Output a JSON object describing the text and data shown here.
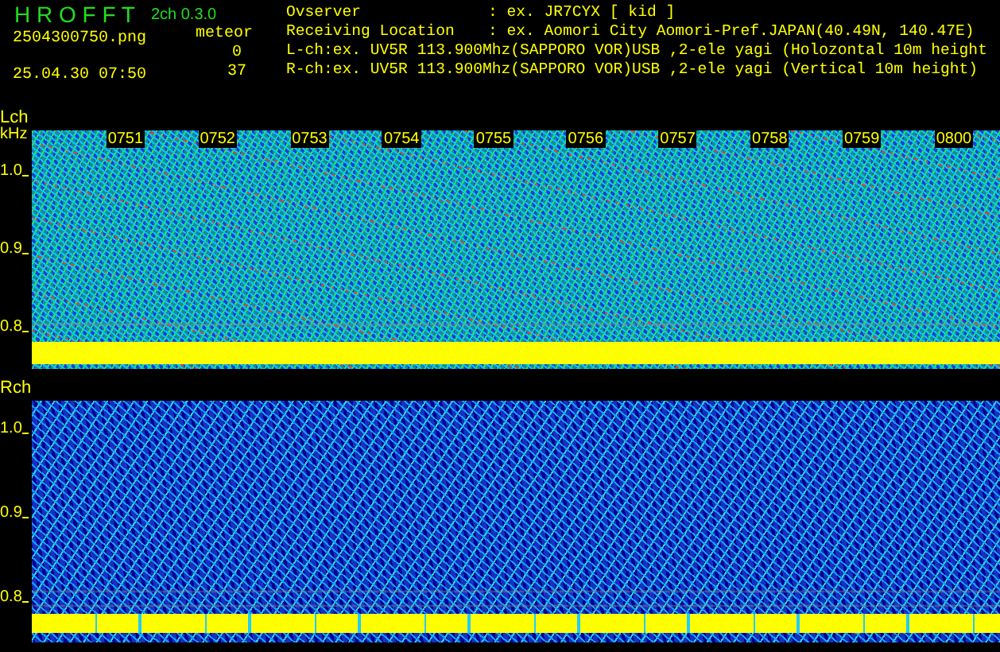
{
  "app": {
    "title": "H R O F F T",
    "version": "2ch 0.3.0",
    "file": "2504300750.png",
    "timestamp": "25.04.30 07:50",
    "meteor_label": "meteor",
    "counts": [
      "0",
      "37"
    ]
  },
  "info": [
    {
      "label": "Ovserver",
      "value": ": ex. JR7CYX [ kid ]"
    },
    {
      "label": "Receiving Location",
      "value": ": ex. Aomori City Aomori-Pref.JAPAN(40.49N, 140.47E)"
    },
    {
      "label": "L-ch:",
      "value": "ex. UV5R 113.900Mhz(SAPPORO VOR)USB ,2-ele yagi (Holozontal 10m height"
    },
    {
      "label": "R-ch:",
      "value": "ex. UV5R 113.900Mhz(SAPPORO VOR)USB ,2-ele yagi (Vertical 10m height)"
    }
  ],
  "channels": [
    {
      "label": "Lch",
      "unit": "kHz",
      "kind": "busy",
      "ticks": [
        "1.0",
        "0.9",
        "0.8"
      ],
      "times": [
        "0751",
        "0752",
        "0753",
        "0754",
        "0755",
        "0756",
        "0757",
        "0758",
        "0759",
        "0800"
      ]
    },
    {
      "label": "Rch",
      "kind": "quiet",
      "ticks": [
        "1.0",
        "0.9",
        "0.8"
      ]
    }
  ]
}
